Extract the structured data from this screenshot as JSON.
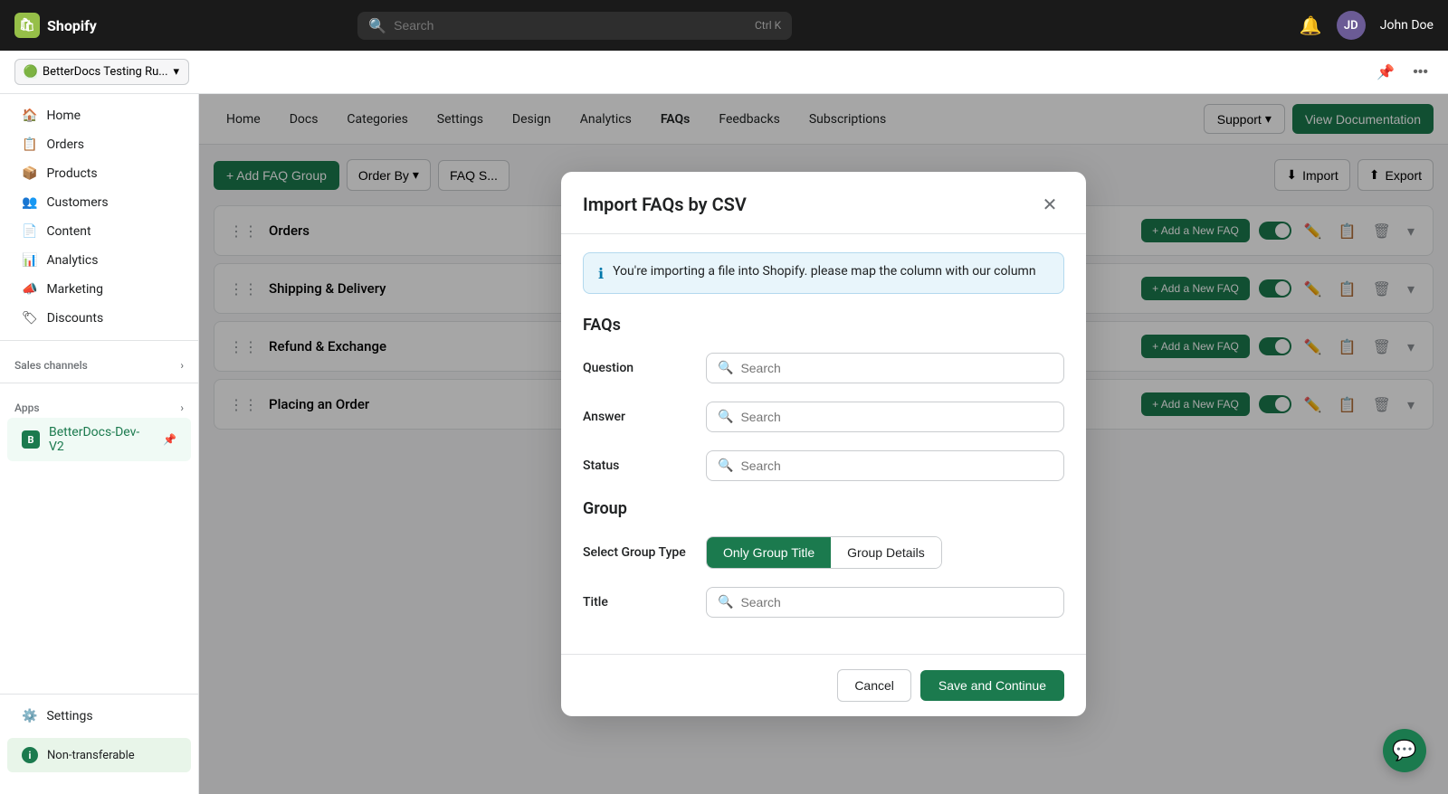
{
  "topbar": {
    "brand": "Shopify",
    "search_placeholder": "Search",
    "shortcut": "Ctrl K",
    "username": "John Doe"
  },
  "store_bar": {
    "store_name": "BetterDocs Testing Ru...",
    "chevron": "▾"
  },
  "sidebar": {
    "items": [
      {
        "id": "home",
        "label": "Home",
        "icon": "🏠"
      },
      {
        "id": "orders",
        "label": "Orders",
        "icon": "📋"
      },
      {
        "id": "products",
        "label": "Products",
        "icon": "📦"
      },
      {
        "id": "customers",
        "label": "Customers",
        "icon": "👥"
      },
      {
        "id": "content",
        "label": "Content",
        "icon": "📄"
      },
      {
        "id": "analytics",
        "label": "Analytics",
        "icon": "📊"
      },
      {
        "id": "marketing",
        "label": "Marketing",
        "icon": "📣"
      },
      {
        "id": "discounts",
        "label": "Discounts",
        "icon": "🏷"
      }
    ],
    "sales_channels_label": "Sales channels",
    "apps_label": "Apps",
    "apps_chevron": "›",
    "active_app": "BetterDocs-Dev-V2",
    "settings_label": "Settings",
    "non_transferable": "Non-transferable"
  },
  "plugin_nav": {
    "items": [
      {
        "id": "home",
        "label": "Home"
      },
      {
        "id": "docs",
        "label": "Docs"
      },
      {
        "id": "categories",
        "label": "Categories"
      },
      {
        "id": "settings",
        "label": "Settings"
      },
      {
        "id": "design",
        "label": "Design"
      },
      {
        "id": "analytics",
        "label": "Analytics"
      },
      {
        "id": "faqs",
        "label": "FAQs",
        "active": true
      },
      {
        "id": "feedbacks",
        "label": "Feedbacks"
      },
      {
        "id": "subscriptions",
        "label": "Subscriptions"
      }
    ],
    "support_label": "Support",
    "view_docs_label": "View Documentation"
  },
  "faq_toolbar": {
    "add_group_label": "+ Add FAQ Group",
    "order_by_label": "Order By",
    "faq_tab_label": "FAQ S...",
    "import_label": "Import",
    "export_label": "Export"
  },
  "faq_rows": [
    {
      "id": "orders",
      "title": "Orders"
    },
    {
      "id": "shipping",
      "title": "Shipping & Delivery"
    },
    {
      "id": "refund",
      "title": "Refund & Exchange"
    },
    {
      "id": "placing",
      "title": "Placing an Order"
    }
  ],
  "modal": {
    "title": "Import FAQs by CSV",
    "info_text": "You're importing a file into Shopify. please map the column with our column",
    "faqs_section_title": "FAQs",
    "question_label": "Question",
    "question_placeholder": "Search",
    "answer_label": "Answer",
    "answer_placeholder": "Search",
    "status_label": "Status",
    "status_placeholder": "Search",
    "group_section_title": "Group",
    "select_group_type_label": "Select Group Type",
    "group_type_options": [
      {
        "id": "only_title",
        "label": "Only Group Title",
        "active": true
      },
      {
        "id": "group_details",
        "label": "Group Details",
        "active": false
      }
    ],
    "title_label": "Title",
    "title_placeholder": "Search",
    "cancel_label": "Cancel",
    "save_label": "Save and Continue"
  }
}
